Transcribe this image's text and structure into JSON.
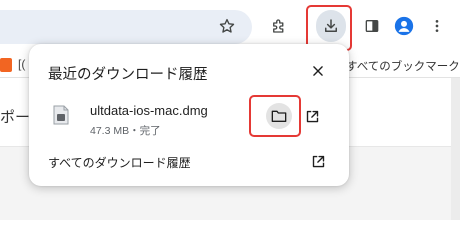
{
  "bookmarks_bar": {
    "left_item": "[(",
    "right_item": "すべてのブックマーク"
  },
  "page": {
    "fragment": "ポー"
  },
  "downloads_bubble": {
    "title": "最近のダウンロード履歴",
    "item": {
      "file_name": "ultdata-ios-mac.dmg",
      "meta": "47.3 MB・完了"
    },
    "all_history_label": "すべてのダウンロード履歴"
  },
  "icons": [
    "star-icon",
    "extensions-icon",
    "download-icon",
    "side-panel-icon",
    "profile-icon",
    "more-menu-icon",
    "close-icon",
    "file-icon",
    "folder-icon",
    "open-external-icon"
  ],
  "colors": {
    "highlight": "#e53935",
    "profile": "#1a73e8",
    "download_button_bg": "#dde3ea",
    "bookmark_favicon": "#f26522"
  }
}
